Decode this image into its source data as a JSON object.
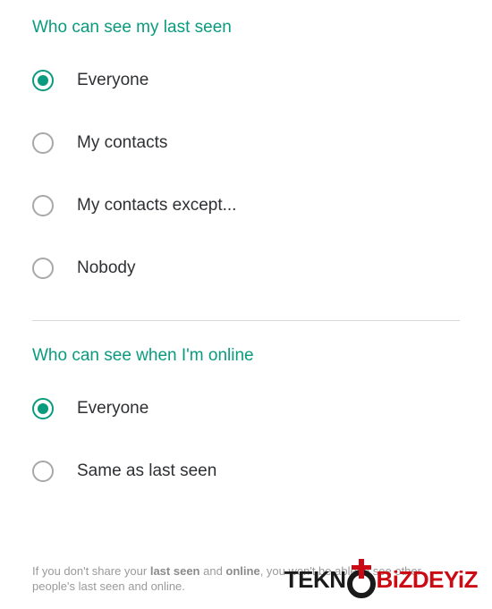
{
  "section1": {
    "title": "Who can see my last seen",
    "options": [
      {
        "label": "Everyone",
        "selected": true
      },
      {
        "label": "My contacts",
        "selected": false
      },
      {
        "label": "My contacts except...",
        "selected": false
      },
      {
        "label": "Nobody",
        "selected": false
      }
    ]
  },
  "section2": {
    "title": "Who can see when I'm online",
    "options": [
      {
        "label": "Everyone",
        "selected": true
      },
      {
        "label": "Same as last seen",
        "selected": false
      }
    ]
  },
  "footnote": {
    "part1": "If you don't share your ",
    "strong1": "last seen",
    "part2": " and ",
    "strong2": "online",
    "part3": ", you won't be able to see other people's last seen and online."
  },
  "logo": {
    "part1": "TEKN",
    "part2": "BiZDEYiZ"
  }
}
